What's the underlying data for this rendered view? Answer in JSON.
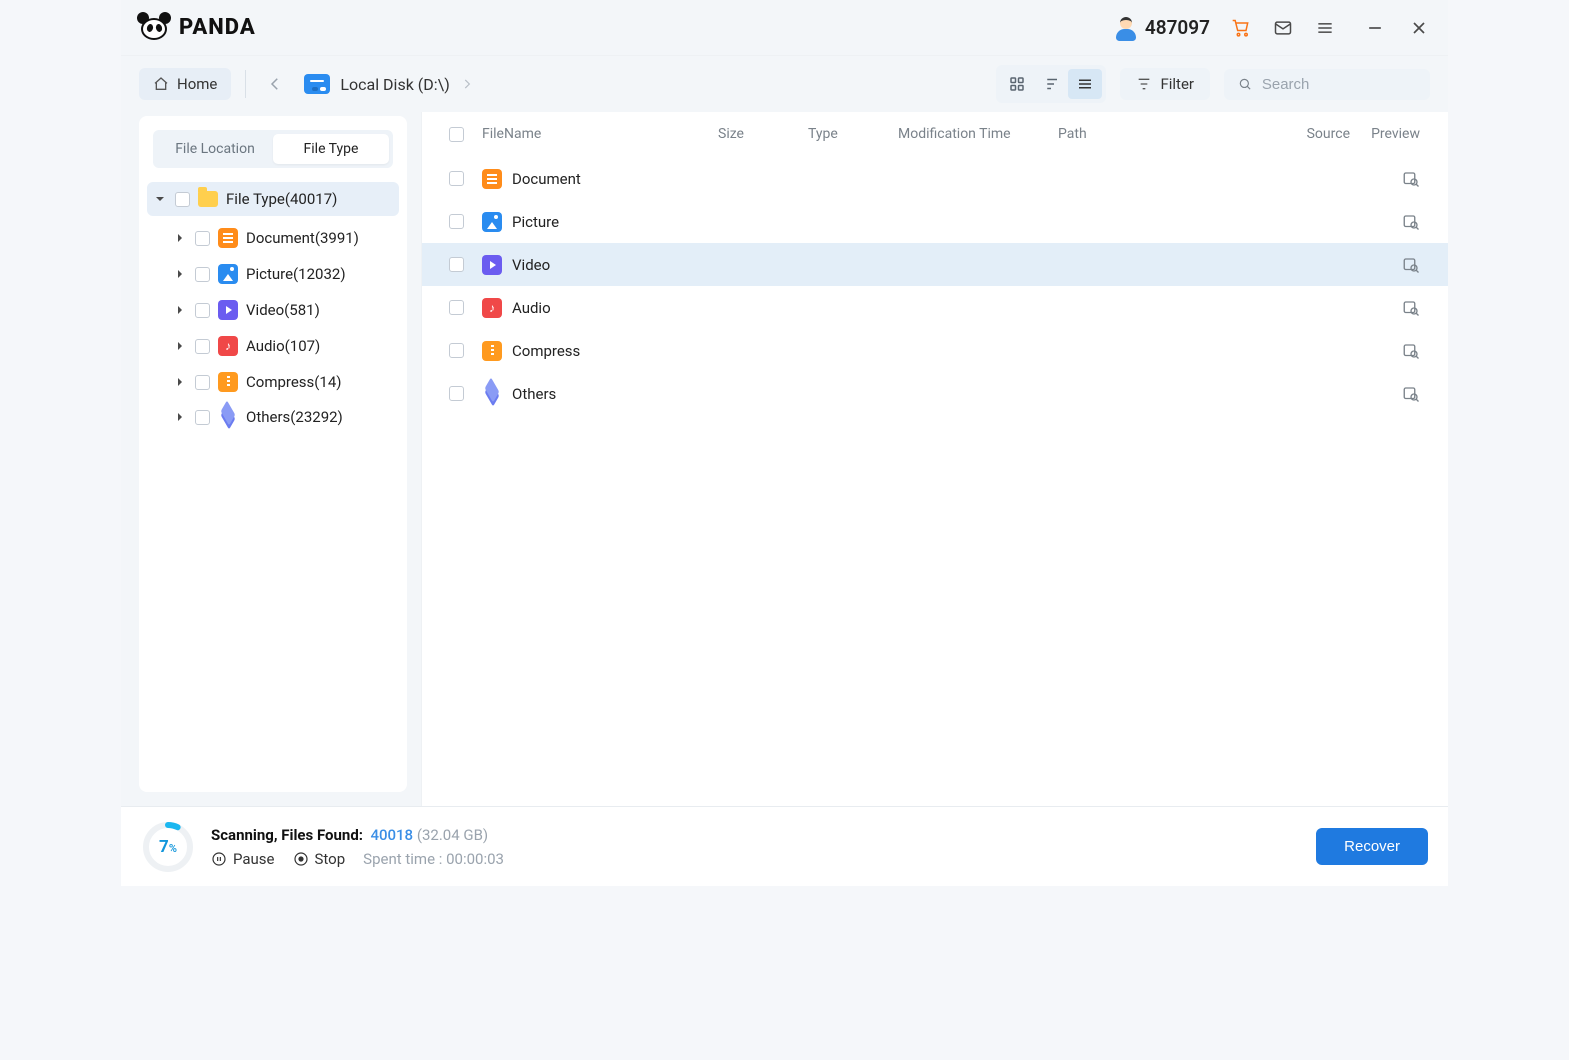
{
  "titlebar": {
    "brand": "PANDA",
    "user_id": "487097"
  },
  "toolbar": {
    "home_label": "Home",
    "breadcrumb": "Local Disk (D:\\)",
    "filter_label": "Filter",
    "search_placeholder": "Search"
  },
  "sidebar": {
    "tabs": {
      "location": "File Location",
      "type": "File Type"
    },
    "root_label": "File Type(40017)",
    "items": [
      {
        "label": "Document(3991)",
        "icon": "ft-doc"
      },
      {
        "label": "Picture(12032)",
        "icon": "ft-pic"
      },
      {
        "label": "Video(581)",
        "icon": "ft-vid"
      },
      {
        "label": "Audio(107)",
        "icon": "ft-aud"
      },
      {
        "label": "Compress(14)",
        "icon": "ft-zip"
      },
      {
        "label": "Others(23292)",
        "icon": "ft-oth"
      }
    ]
  },
  "table": {
    "headers": {
      "name": "FileName",
      "size": "Size",
      "type": "Type",
      "mod": "Modification Time",
      "path": "Path",
      "source": "Source",
      "preview": "Preview"
    },
    "rows": [
      {
        "name": "Document",
        "icon": "ft-doc",
        "selected": false
      },
      {
        "name": "Picture",
        "icon": "ft-pic",
        "selected": false
      },
      {
        "name": "Video",
        "icon": "ft-vid",
        "selected": true
      },
      {
        "name": "Audio",
        "icon": "ft-aud",
        "selected": false
      },
      {
        "name": "Compress",
        "icon": "ft-zip",
        "selected": false
      },
      {
        "name": "Others",
        "icon": "ft-oth",
        "selected": false
      }
    ]
  },
  "status": {
    "percent": "7",
    "scan_label": "Scanning, Files Found:",
    "found": "40018",
    "size": "(32.04 GB)",
    "pause": "Pause",
    "stop": "Stop",
    "spent_label": "Spent time : ",
    "spent_time": "00:00:03",
    "recover": "Recover"
  }
}
